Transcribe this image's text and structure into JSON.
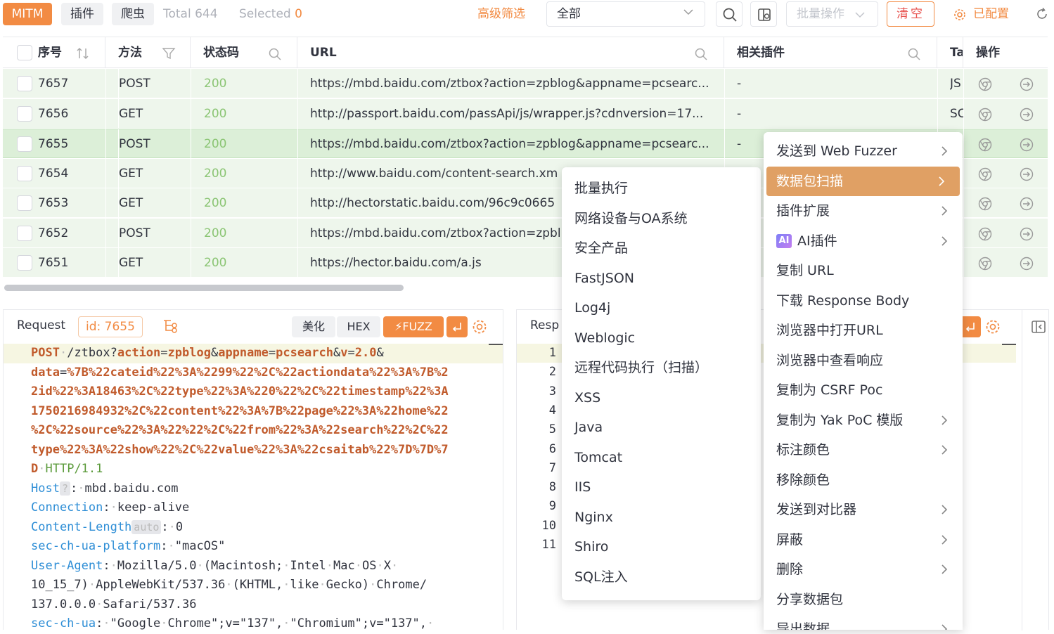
{
  "toolbar": {
    "tab_mitm": "MITM",
    "tab_plugin": "插件",
    "tab_crawler": "爬虫",
    "total_label": "Total",
    "total_value": "644",
    "selected_label": "Selected",
    "selected_value": "0",
    "advanced_filter": "高级筛选",
    "filter_select_value": "全部",
    "batch_ops": "批量操作",
    "clear": "清空",
    "configured": "已配置"
  },
  "table": {
    "headers": {
      "index": "序号",
      "method": "方法",
      "status": "状态码",
      "url": "URL",
      "plugins": "相关插件",
      "tags": "Ta",
      "actions": "操作"
    },
    "rows": [
      {
        "index": "7657",
        "method": "POST",
        "status": "200",
        "url": "https://mbd.baidu.com/ztbox?action=zpblog&appname=pcsearc...",
        "plugins": "-",
        "tags": "JS"
      },
      {
        "index": "7656",
        "method": "GET",
        "status": "200",
        "url": "http://passport.baidu.com/passApi/js/wrapper.js?cdnversion=17...",
        "plugins": "-",
        "tags": "SC"
      },
      {
        "index": "7655",
        "method": "POST",
        "status": "200",
        "url": "https://mbd.baidu.com/ztbox?action=zpblog&appname=pcsearc...",
        "plugins": "-",
        "tags": ""
      },
      {
        "index": "7654",
        "method": "GET",
        "status": "200",
        "url": "http://www.baidu.com/content-search.xm",
        "plugins": "",
        "tags": ""
      },
      {
        "index": "7653",
        "method": "GET",
        "status": "200",
        "url": "http://hectorstatic.baidu.com/96c9c0665",
        "plugins": "",
        "tags": ""
      },
      {
        "index": "7652",
        "method": "POST",
        "status": "200",
        "url": "https://mbd.baidu.com/ztbox?action=zpbl",
        "plugins": "",
        "tags": ""
      },
      {
        "index": "7651",
        "method": "GET",
        "status": "200",
        "url": "https://hector.baidu.com/a.js",
        "plugins": "",
        "tags": ""
      }
    ]
  },
  "request": {
    "title": "Request",
    "id_label": "id:",
    "id_value": "7655",
    "beautify": "美化",
    "hex": "HEX",
    "fuzz": "FUZZ",
    "host_chip": "?",
    "length_chip": "auto"
  },
  "response": {
    "title": "Resp",
    "line_numbers": [
      "1",
      "2",
      "3",
      "4",
      "5",
      "6",
      "7",
      "8",
      "9",
      "10",
      "11"
    ]
  },
  "submenu": {
    "items": [
      "批量执行",
      "网络设备与OA系统",
      "安全产品",
      "FastJSON",
      "Log4j",
      "Weblogic",
      "远程代码执行（扫描）",
      "XSS",
      "Java",
      "Tomcat",
      "IIS",
      "Nginx",
      "Shiro",
      "SQL注入"
    ]
  },
  "context_menu": {
    "ai_badge": "AI",
    "items": [
      {
        "label": "发送到 Web Fuzzer",
        "arrow": true
      },
      {
        "label": "数据包扫描",
        "arrow": true,
        "active": true
      },
      {
        "label": "插件扩展",
        "arrow": true
      },
      {
        "label": "AI插件",
        "arrow": true
      },
      {
        "label": "复制 URL",
        "arrow": false
      },
      {
        "label": "下载 Response Body",
        "arrow": false
      },
      {
        "label": "浏览器中打开URL",
        "arrow": false
      },
      {
        "label": "浏览器中查看响应",
        "arrow": false
      },
      {
        "label": "复制为 CSRF Poc",
        "arrow": false
      },
      {
        "label": "复制为 Yak PoC 模版",
        "arrow": true
      },
      {
        "label": "标注颜色",
        "arrow": true
      },
      {
        "label": "移除颜色",
        "arrow": false
      },
      {
        "label": "发送到对比器",
        "arrow": true
      },
      {
        "label": "屏蔽",
        "arrow": true
      },
      {
        "label": "删除",
        "arrow": true
      },
      {
        "label": "分享数据包",
        "arrow": false
      },
      {
        "label": "导出数据",
        "arrow": true
      }
    ]
  },
  "colors": {
    "accent": "#f28b43",
    "row_bg": "#eef6ec",
    "status_green": "#8bc574",
    "menu_active": "#e0a064"
  }
}
